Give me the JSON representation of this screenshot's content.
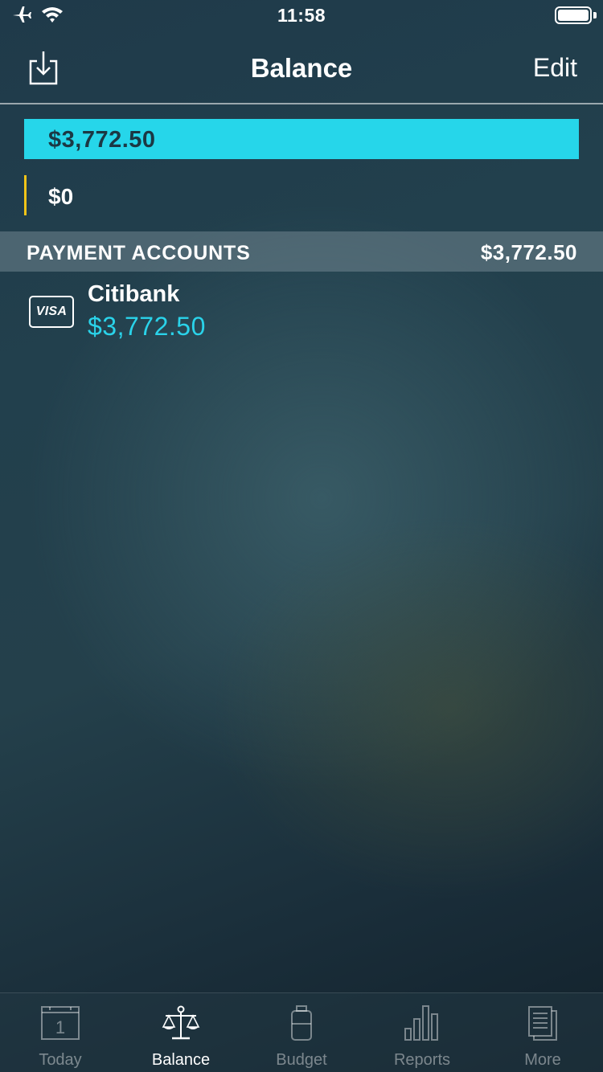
{
  "status_bar": {
    "time": "11:58",
    "icons": [
      "airplane-icon",
      "wifi-icon",
      "battery-icon"
    ]
  },
  "nav": {
    "title": "Balance",
    "edit_label": "Edit",
    "left_icon": "import-icon"
  },
  "summary": {
    "primary_amount": "$3,772.50",
    "secondary_amount": "$0",
    "colors": {
      "primary": "#26d6ea",
      "secondary_accent": "#f0c419"
    }
  },
  "section": {
    "title": "PAYMENT ACCOUNTS",
    "total": "$3,772.50"
  },
  "accounts": [
    {
      "icon": "visa-card-icon",
      "icon_text": "VISA",
      "name": "Citibank",
      "balance": "$3,772.50"
    }
  ],
  "tabs": [
    {
      "label": "Today",
      "icon": "calendar-icon",
      "calendar_day": "1",
      "active": false
    },
    {
      "label": "Balance",
      "icon": "scale-icon",
      "active": true
    },
    {
      "label": "Budget",
      "icon": "budget-jar-icon",
      "active": false
    },
    {
      "label": "Reports",
      "icon": "bar-chart-icon",
      "active": false
    },
    {
      "label": "More",
      "icon": "documents-icon",
      "active": false
    }
  ],
  "theme": {
    "accent": "#26d6ea"
  }
}
